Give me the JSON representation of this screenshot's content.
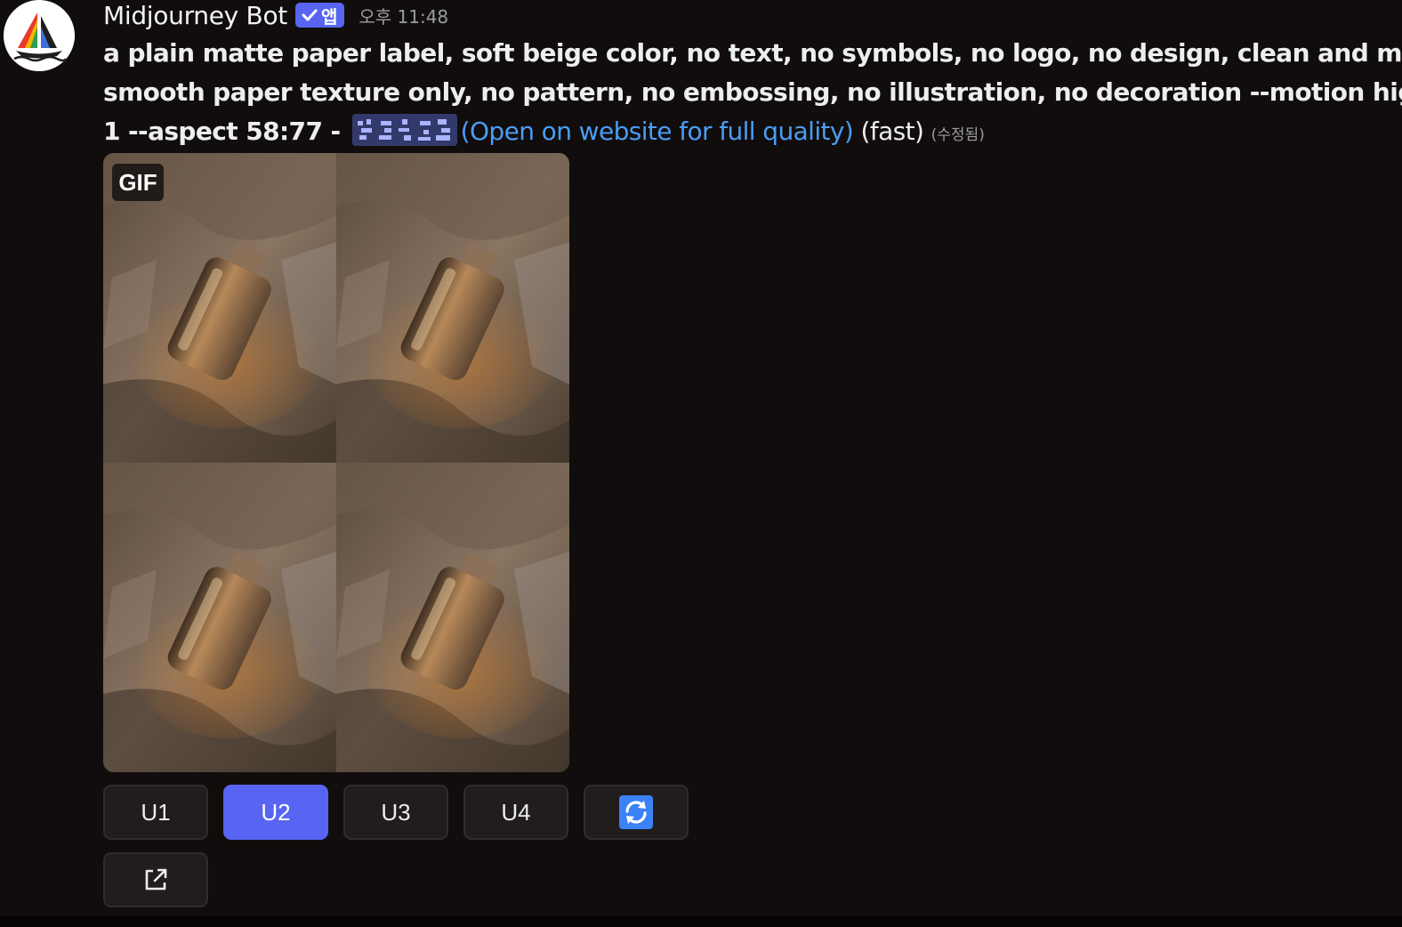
{
  "header": {
    "username": "Midjourney Bot",
    "app_badge": "앱",
    "timestamp": "오후 11:48"
  },
  "message": {
    "line1": "a plain matte paper label, soft beige color, no text, no symbols, no logo, no design, clean and minimal,",
    "line2": "smooth paper texture only, no pattern, no embossing, no illustration, no decoration --motion high --video",
    "line3_prefix": "1 --aspect 58:77 - ",
    "link_text": "(Open on website for full quality)",
    "speed": " (fast) ",
    "edited": "(수정됨)"
  },
  "image": {
    "badge": "GIF"
  },
  "buttons": {
    "u1": "U1",
    "u2": "U2",
    "u3": "U3",
    "u4": "U4",
    "active": "U2",
    "refresh_icon": "refresh-icon",
    "external_icon": "external-link-icon"
  },
  "colors": {
    "background": "#110d0c",
    "accent": "#5865f2",
    "link": "#4a9df5",
    "button": "#201d1c"
  }
}
